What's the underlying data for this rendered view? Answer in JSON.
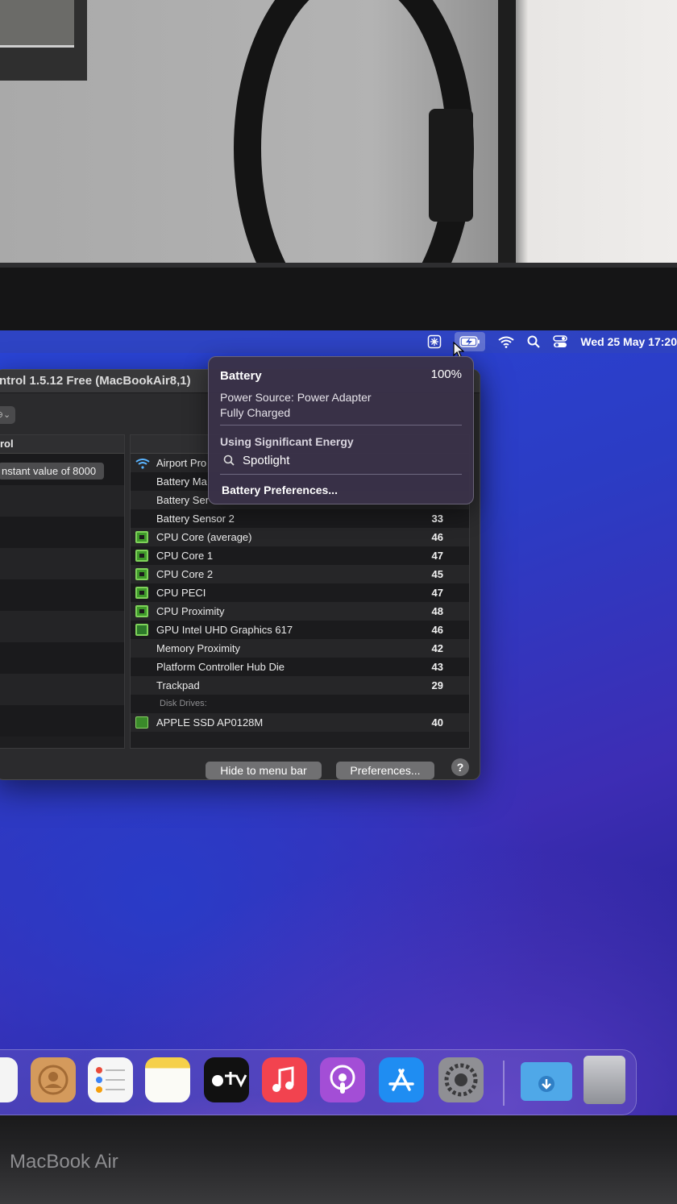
{
  "device": {
    "label": "MacBook Air"
  },
  "menubar": {
    "clock": "Wed 25 May  17:20"
  },
  "window": {
    "title": "ntrol 1.5.12 Free (MacBookAir8,1)",
    "left_header": "rol",
    "left_chip": "nstant value of 8000",
    "sensors": [
      {
        "icon": "wifi-icon",
        "name": "Airport Pro",
        "value": ""
      },
      {
        "icon": "",
        "name": "Battery Ma",
        "value": ""
      },
      {
        "icon": "",
        "name": "Battery Ser",
        "value": ""
      },
      {
        "icon": "",
        "name": "Battery Sensor 2",
        "value": "33"
      },
      {
        "icon": "chip-icon",
        "name": "CPU Core (average)",
        "value": "46"
      },
      {
        "icon": "chip-icon",
        "name": "CPU Core 1",
        "value": "47"
      },
      {
        "icon": "chip-icon",
        "name": "CPU Core 2",
        "value": "45"
      },
      {
        "icon": "chip-icon",
        "name": "CPU PECI",
        "value": "47"
      },
      {
        "icon": "chip-icon",
        "name": "CPU Proximity",
        "value": "48"
      },
      {
        "icon": "gpu-icon",
        "name": "GPU Intel UHD Graphics 617",
        "value": "46"
      },
      {
        "icon": "",
        "name": "Memory Proximity",
        "value": "42"
      },
      {
        "icon": "",
        "name": "Platform Controller Hub Die",
        "value": "43"
      },
      {
        "icon": "",
        "name": "Trackpad",
        "value": "29"
      }
    ],
    "section_label": "Disk Drives:",
    "disks": [
      {
        "icon": "ssd-icon",
        "name": "APPLE SSD AP0128M",
        "value": "40"
      }
    ],
    "buttons": {
      "hide": "Hide to menu bar",
      "preferences": "Preferences...",
      "help": "?"
    }
  },
  "battery_popup": {
    "title": "Battery",
    "percent": "100%",
    "power_source": "Power Source: Power Adapter",
    "status": "Fully Charged",
    "energy_heading": "Using Significant Energy",
    "energy_app": "Spotlight",
    "preferences_link": "Battery Preferences..."
  },
  "dock": {
    "apps": [
      "calendar",
      "contacts",
      "reminders",
      "notes",
      "tv",
      "music",
      "podcasts",
      "app-store",
      "system-preferences",
      "downloads",
      "trash"
    ]
  },
  "colors": {
    "wallpaper_blue": "#2a45d8",
    "sensor_green": "#7fd25a",
    "popup_bg": "#3a3248"
  }
}
